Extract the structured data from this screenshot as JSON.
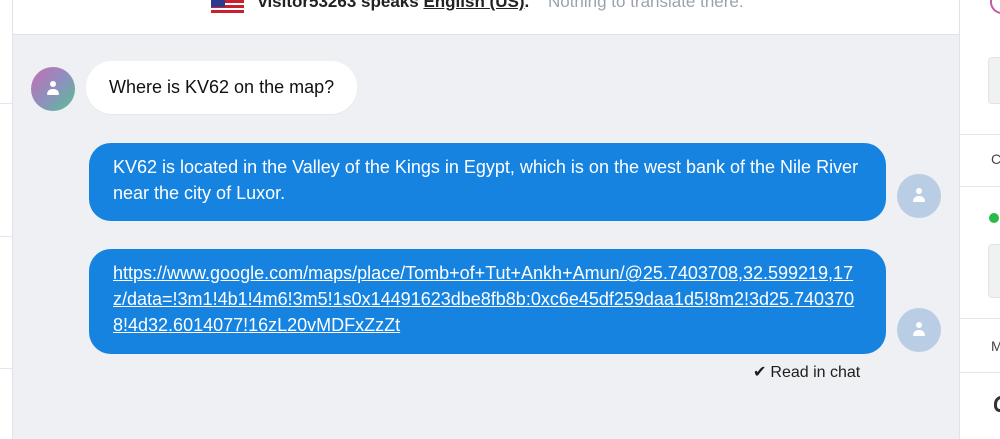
{
  "translation_bar": {
    "visitor_name": "visitor53263",
    "speaks_text": "speaks",
    "language": "English (US)",
    "period": ".",
    "note": "Nothing to translate there."
  },
  "messages": [
    {
      "sender": "visitor",
      "text": "Where is KV62 on the map?"
    },
    {
      "sender": "agent",
      "text": "KV62 is located in the Valley of the Kings in Egypt, which is on the west bank of the Nile River near the city of Luxor."
    },
    {
      "sender": "agent",
      "text": "https://www.google.com/maps/place/Tomb+of+Tut+Ankh+Amun/@25.7403708,32.599219,17z/data=!3m1!4b1!4m6!3m5!1s0x14491623dbe8fb8b:0xc6e45df259daa1d5!8m2!3d25.7403708!4d32.6014077!16zL20vMDFxZzZt"
    }
  ],
  "read_receipt": {
    "check": "✔",
    "label": "Read in chat"
  },
  "right_panel": {
    "letter_c": "C",
    "letter_m": "M"
  },
  "colors": {
    "agent_bubble": "#1683e0",
    "visitor_bubble": "#ffffff",
    "background": "#eef0f3",
    "online_dot": "#2bb94a"
  }
}
